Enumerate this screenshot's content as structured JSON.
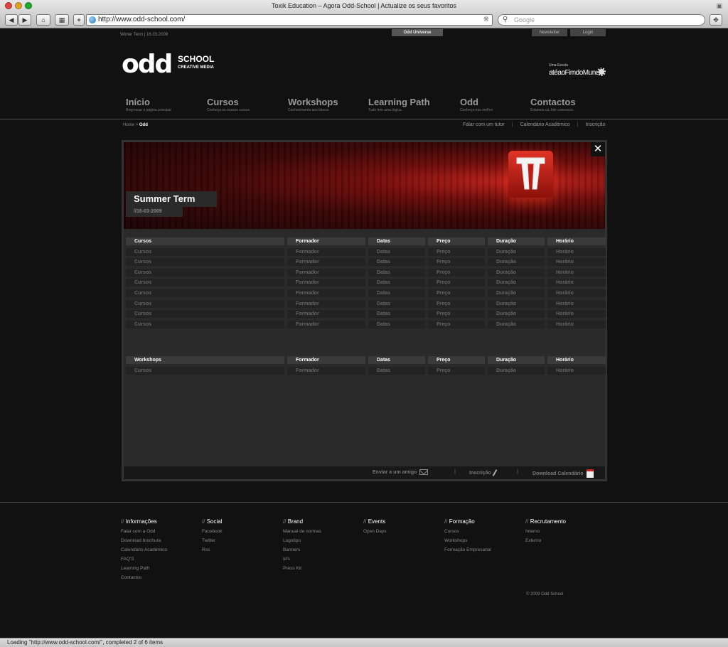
{
  "browser": {
    "window_title": "Toxik Education – Agora Odd-School | Actualize os seus favoritos",
    "url": "http://www.odd-school.com/",
    "search_placeholder": "Google",
    "status_text": "Loading \"http://www.odd-school.com/\", completed 2 of 6 items"
  },
  "top": {
    "term_info": "Winter Term | 16.03.2009",
    "odd_universe": "Odd Universe",
    "newsletter": "Newsletter",
    "login": "Login"
  },
  "logo": {
    "odd": "odd",
    "school": "SCHOOL",
    "sub": "CREATIVE MEDIA"
  },
  "partner": {
    "small": "Uma Escola",
    "name": "atéaoFimdoMundo"
  },
  "nav": [
    {
      "label": "Início",
      "sub": "Regressar à página principal"
    },
    {
      "label": "Cursos",
      "sub": "Conheça os nossos cursos"
    },
    {
      "label": "Workshops",
      "sub": "Conhecimento aos blocos"
    },
    {
      "label": "Learning Path",
      "sub": "Tudo tem uma lógica"
    },
    {
      "label": "Odd",
      "sub": "Conheça-nos melhor"
    },
    {
      "label": "Contactos",
      "sub": "Estamos cá, fale connosco."
    }
  ],
  "breadcrumb": {
    "home": "Home",
    "sep": ">",
    "current": "Odd"
  },
  "util_links": [
    "Falar com um tutor",
    "Calendário Académico",
    "Inscrição"
  ],
  "term": {
    "title": "Summer Term",
    "date": "//16-03-2009"
  },
  "courses_table": {
    "headers": [
      "Cursos",
      "Formador",
      "Datas",
      "Preço",
      "Duração",
      "Horário"
    ],
    "rows": [
      [
        "Cursos",
        "Formador",
        "Datas",
        "Preço",
        "Duração",
        "Horário"
      ],
      [
        "Cursos",
        "Formador",
        "Datas",
        "Preço",
        "Duração",
        "Horário"
      ],
      [
        "Cursos",
        "Formador",
        "Datas",
        "Preço",
        "Duração",
        "Horário"
      ],
      [
        "Cursos",
        "Formador",
        "Datas",
        "Preço",
        "Duração",
        "Horário"
      ],
      [
        "Cursos",
        "Formador",
        "Datas",
        "Preço",
        "Duração",
        "Horário"
      ],
      [
        "Cursos",
        "Formador",
        "Datas",
        "Preço",
        "Duração",
        "Horário"
      ],
      [
        "Cursos",
        "Formador",
        "Datas",
        "Preço",
        "Duração",
        "Horário"
      ],
      [
        "Cursos",
        "Formador",
        "Datas",
        "Preço",
        "Duração",
        "Horário"
      ]
    ]
  },
  "workshops_table": {
    "headers": [
      "Workshops",
      "Formador",
      "Datas",
      "Preço",
      "Duração",
      "Horário"
    ],
    "rows": [
      [
        "Cursos",
        "Formador",
        "Datas",
        "Preço",
        "Duração",
        "Horário"
      ]
    ]
  },
  "panel_footer": {
    "send_friend": "Enviar a um amigo",
    "inscricao": "Inscrição",
    "download_calendar": "Download Calendário",
    "sep": "|"
  },
  "footer": {
    "slash": "//",
    "columns": [
      {
        "title": "Informações",
        "links": [
          "Falar com a Odd",
          "Download brochura",
          "Calendário Académico",
          "FAQ'S",
          "Learning Path",
          "Contactos"
        ]
      },
      {
        "title": "Social",
        "links": [
          "Facebook",
          "Twitter",
          "Rss"
        ]
      },
      {
        "title": "Brand",
        "links": [
          "Manual de normas",
          "Logotipo",
          "Banners",
          "Id's",
          "Press Kit"
        ]
      },
      {
        "title": "Events",
        "links": [
          "Open Days"
        ]
      },
      {
        "title": "Formação",
        "links": [
          "Cursos",
          "Workshops",
          "Formação Empresarial"
        ]
      },
      {
        "title": "Recrutamento",
        "links": [
          "Interno",
          "Externo"
        ]
      }
    ],
    "copyright": "© 2009 Odd School"
  }
}
